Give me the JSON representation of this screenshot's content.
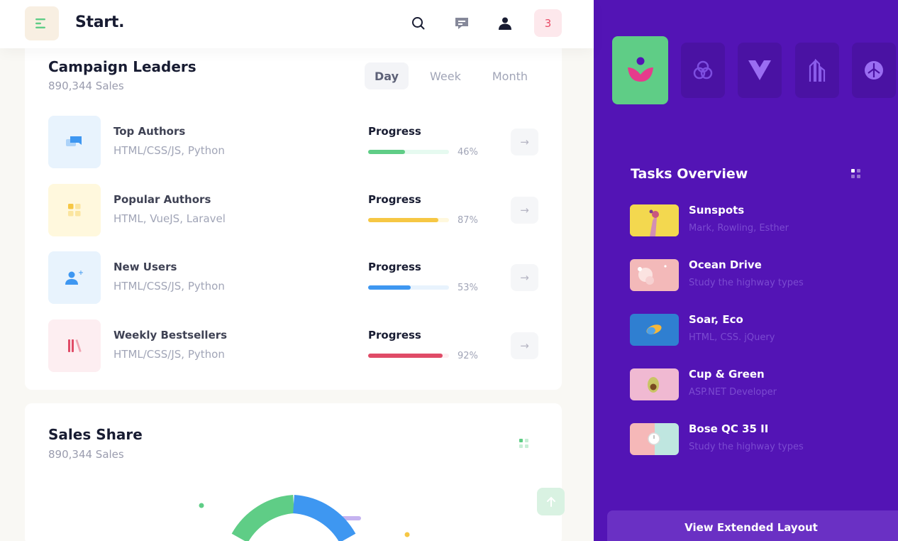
{
  "header": {
    "brand": "Start.",
    "notification_count": "3",
    "icons": [
      "menu-icon",
      "search-icon",
      "message-icon",
      "user-icon"
    ]
  },
  "campaign": {
    "title": "Campaign Leaders",
    "subtitle": "890,344 Sales",
    "tabs": [
      {
        "label": "Day",
        "active": true
      },
      {
        "label": "Week",
        "active": false
      },
      {
        "label": "Month",
        "active": false
      }
    ],
    "rows": [
      {
        "name": "Top Authors",
        "desc": "HTML/CSS/JS, Python",
        "progress_label": "Progress",
        "percent_text": "46%",
        "percent": 46,
        "color": "#5fcd86",
        "track": "#e6faf0",
        "icon_bg": "#e8f3fd",
        "icon": "chat-icon"
      },
      {
        "name": "Popular Authors",
        "desc": "HTML, VueJS, Laravel",
        "progress_label": "Progress",
        "percent_text": "87%",
        "percent": 87,
        "color": "#f6c744",
        "track": "#fff8dd",
        "icon_bg": "#fff8dd",
        "icon": "grid-icon"
      },
      {
        "name": "New Users",
        "desc": "HTML/CSS/JS, Python",
        "progress_label": "Progress",
        "percent_text": "53%",
        "percent": 53,
        "color": "#3e97f1",
        "track": "#e8f3fd",
        "icon_bg": "#e8f3fd",
        "icon": "user-add-icon"
      },
      {
        "name": "Weekly Bestsellers",
        "desc": "HTML/CSS/JS, Python",
        "progress_label": "Progress",
        "percent_text": "92%",
        "percent": 92,
        "color": "#e04b67",
        "track": "#fdeef1",
        "icon_bg": "#fdeef1",
        "icon": "library-icon"
      }
    ]
  },
  "sales_share": {
    "title": "Sales Share",
    "subtitle": "890,344 Sales"
  },
  "panel": {
    "tasks_title": "Tasks Overview",
    "tasks": [
      {
        "name": "Sunspots",
        "desc": "Mark, Rowling, Esther"
      },
      {
        "name": "Ocean Drive",
        "desc": "Study the highway types"
      },
      {
        "name": "Soar, Eco",
        "desc": "HTML, CSS. jQuery"
      },
      {
        "name": "Cup & Green",
        "desc": "ASP.NET Developer"
      },
      {
        "name": "Bose QC 35 II",
        "desc": "Study the highway types"
      }
    ],
    "view_button": "View Extended Layout"
  }
}
